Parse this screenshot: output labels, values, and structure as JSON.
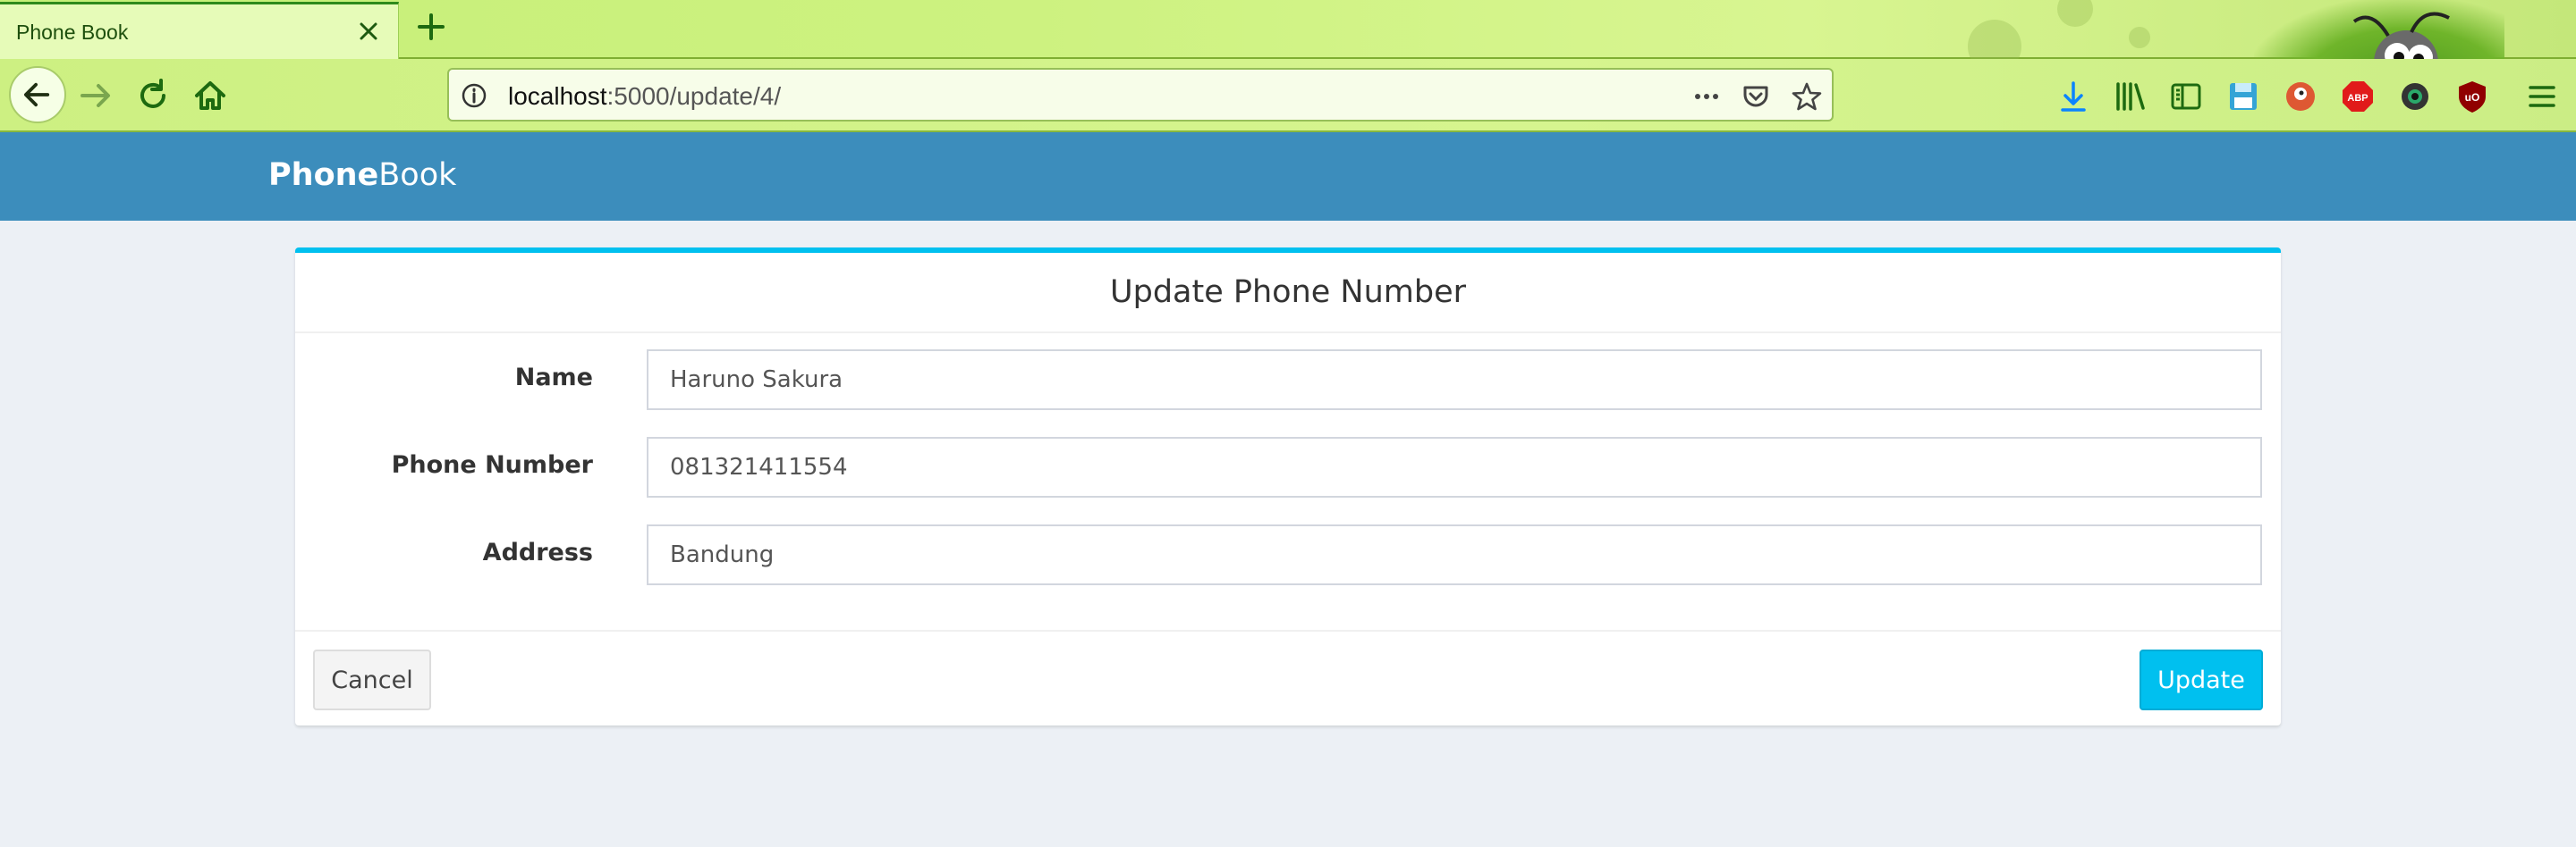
{
  "browser": {
    "tab": {
      "title": "Phone Book"
    },
    "url": {
      "host": "localhost",
      "path": ":5000/update/4/"
    },
    "accent_color": "#2e8a1c"
  },
  "app": {
    "brand_strong": "Phone",
    "brand_light": "Book",
    "navbar_color": "#3c8dbc"
  },
  "form": {
    "title": "Update Phone Number",
    "fields": [
      {
        "label": "Name",
        "value": "Haruno Sakura"
      },
      {
        "label": "Phone Number",
        "value": "081321411554"
      },
      {
        "label": "Address",
        "value": "Bandung"
      }
    ],
    "cancel_label": "Cancel",
    "update_label": "Update",
    "accent_color": "#00c0ef"
  },
  "toolbar_icons": [
    "download-icon",
    "library-icon",
    "sidebar-icon",
    "save-icon",
    "duckduckgo-icon",
    "adblock-icon",
    "extension-icon",
    "ublock-icon",
    "hamburger-menu-icon"
  ]
}
